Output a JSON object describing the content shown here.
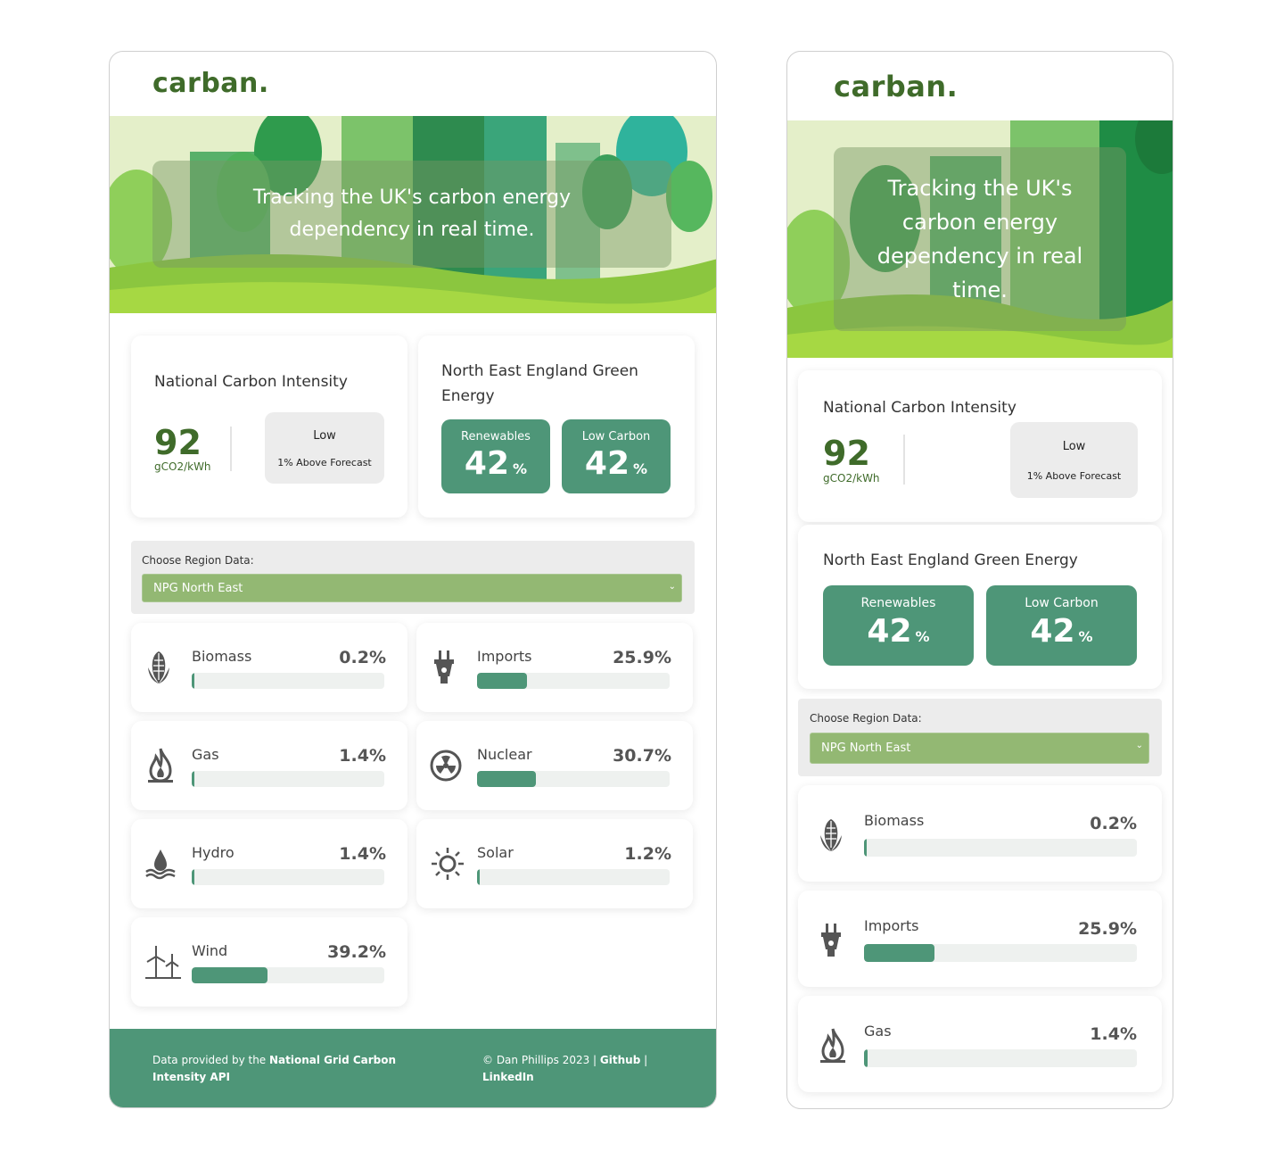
{
  "brand": {
    "logo": "carban."
  },
  "hero": {
    "tagline": "Tracking the UK's carbon energy dependency in real time."
  },
  "national": {
    "title": "National Carbon Intensity",
    "value": "92",
    "unit": "gCO2/kWh",
    "status": "Low",
    "forecast": "1% Above Forecast"
  },
  "regional_green": {
    "title": "North East England Green Energy",
    "renewables_label": "Renewables",
    "renewables_value": "42",
    "low_carbon_label": "Low Carbon",
    "low_carbon_value": "42",
    "percent_symbol": "%"
  },
  "region_select": {
    "label": "Choose Region Data:",
    "selected": "NPG North East"
  },
  "fuels": [
    {
      "name": "Biomass",
      "value": "0.2%",
      "pct": 0.2,
      "icon": "corn-icon"
    },
    {
      "name": "Imports",
      "value": "25.9%",
      "pct": 25.9,
      "icon": "plug-icon"
    },
    {
      "name": "Gas",
      "value": "1.4%",
      "pct": 1.4,
      "icon": "flame-icon"
    },
    {
      "name": "Nuclear",
      "value": "30.7%",
      "pct": 30.7,
      "icon": "radiation-icon"
    },
    {
      "name": "Hydro",
      "value": "1.4%",
      "pct": 1.4,
      "icon": "water-drop-icon"
    },
    {
      "name": "Solar",
      "value": "1.2%",
      "pct": 1.2,
      "icon": "sun-icon"
    },
    {
      "name": "Wind",
      "value": "39.2%",
      "pct": 39.2,
      "icon": "wind-turbine-icon"
    }
  ],
  "footer": {
    "data_prefix": "Data provided by the ",
    "data_source": "National Grid Carbon Intensity API",
    "copyright": "© Dan Phillips 2023 | ",
    "github": "Github",
    "sep": " | ",
    "linkedin": "LinkedIn"
  },
  "colors": {
    "brand_green": "#3f6b2a",
    "accent": "#4e9678",
    "select_bg": "#93b873"
  }
}
